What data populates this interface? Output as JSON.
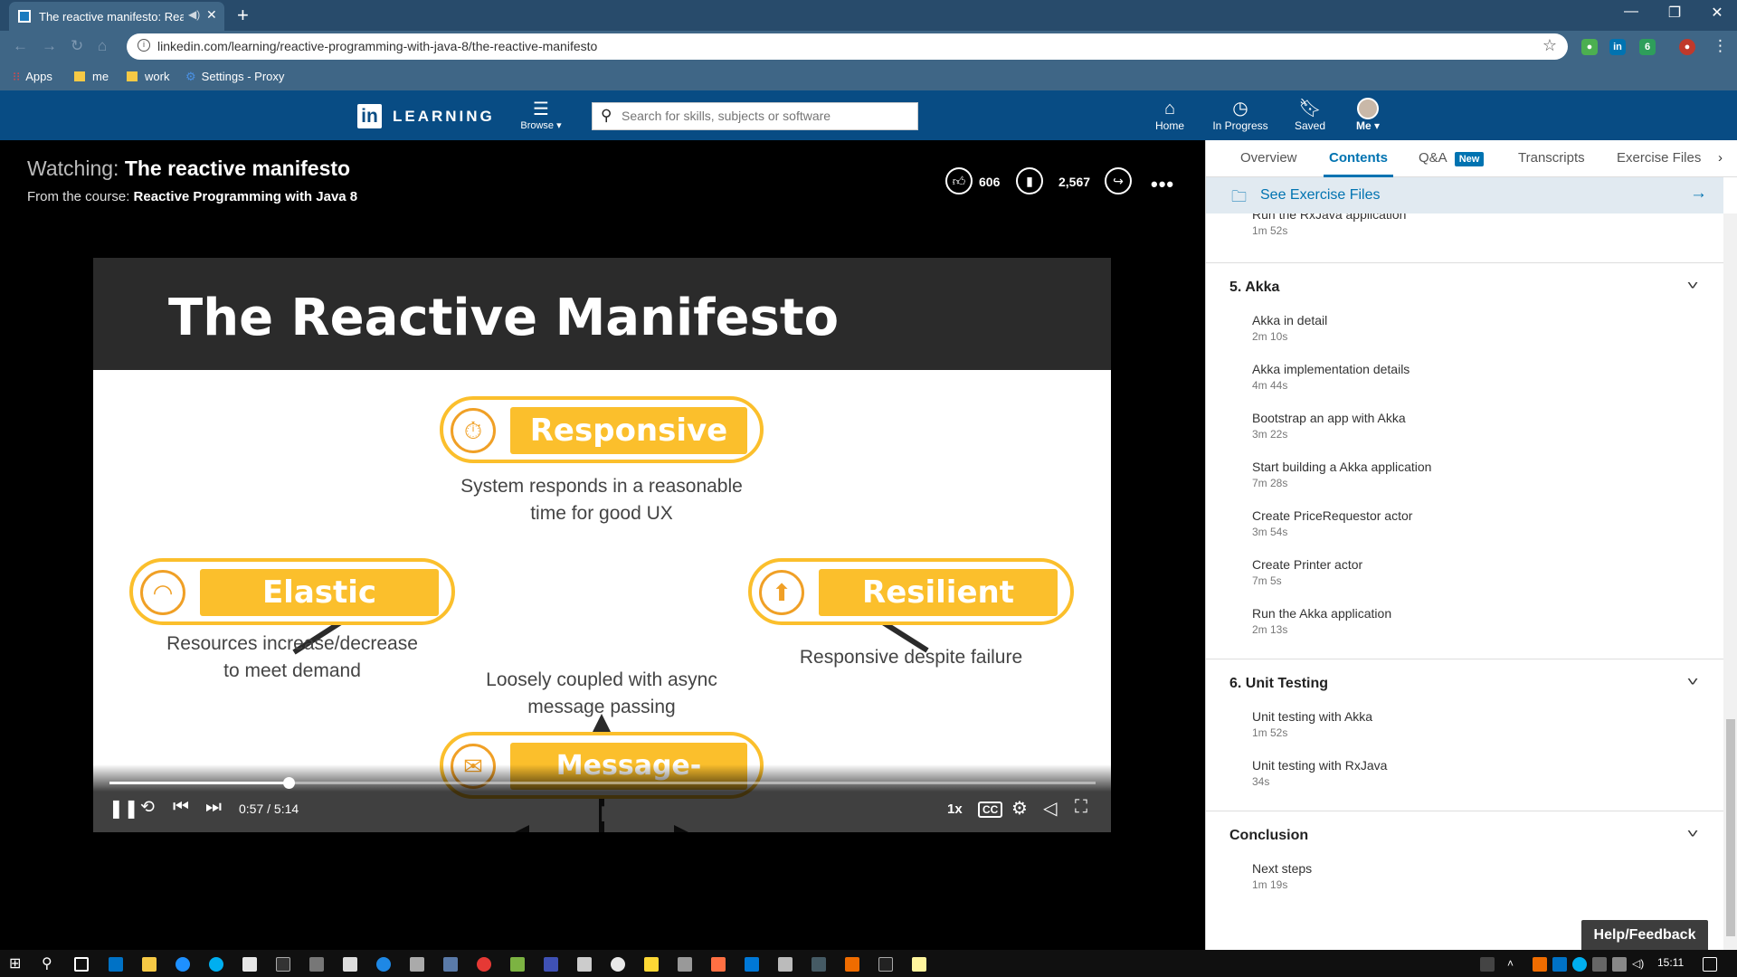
{
  "browser": {
    "tab_title": "The reactive manifesto: React",
    "url": "linkedin.com/learning/reactive-programming-with-java-8/the-reactive-manifesto",
    "bookmarks": [
      "Apps",
      "me",
      "work",
      "Settings - Proxy"
    ],
    "extension_badge": "6"
  },
  "header": {
    "logo": "in",
    "brand": "LEARNING",
    "browse": "Browse ▾",
    "search_placeholder": "Search for skills, subjects or software",
    "nav": [
      {
        "label": "Home",
        "icon": "home-icon"
      },
      {
        "label": "In Progress",
        "icon": "clock-icon"
      },
      {
        "label": "Saved",
        "icon": "bookmark-icon"
      },
      {
        "label": "Me ▾",
        "icon": "avatar"
      }
    ]
  },
  "video_info": {
    "watching_prefix": "Watching:",
    "title": "The reactive manifesto",
    "course_prefix": "From the course:",
    "course": "Reactive Programming with Java 8",
    "likes": "606",
    "saves": "2,567"
  },
  "slide": {
    "title": "The Reactive Manifesto",
    "responsive": {
      "label": "Responsive",
      "desc_1": "System responds in a reasonable",
      "desc_2": "time for good UX"
    },
    "elastic": {
      "label": "Elastic",
      "desc_1": "Resources increase/decrease",
      "desc_2": "to meet demand"
    },
    "resilient": {
      "label": "Resilient",
      "desc_1": "Responsive despite failure"
    },
    "message_driven": {
      "label": "Message-driven",
      "desc_1": "Loosely coupled with async",
      "desc_2": "message passing"
    },
    "accent_color": "#fbbf2c"
  },
  "player": {
    "time": "0:57 / 5:14",
    "progress_fraction": 0.182,
    "speed": "1x",
    "cc": "CC"
  },
  "panel": {
    "tabs": [
      "Overview",
      "Contents",
      "Q&A",
      "Transcripts",
      "Exercise Files"
    ],
    "new_badge": "New",
    "active_tab": "Contents",
    "exercise_files": "See Exercise Files",
    "prev_item": {
      "title": "Run the RxJava application",
      "duration": "1m 52s"
    },
    "chapters": [
      {
        "title": "5. Akka",
        "items": [
          {
            "title": "Akka in detail",
            "duration": "2m 10s"
          },
          {
            "title": "Akka implementation details",
            "duration": "4m 44s"
          },
          {
            "title": "Bootstrap an app with Akka",
            "duration": "3m 22s"
          },
          {
            "title": "Start building a Akka application",
            "duration": "7m 28s"
          },
          {
            "title": "Create PriceRequestor actor",
            "duration": "3m 54s"
          },
          {
            "title": "Create Printer actor",
            "duration": "7m 5s"
          },
          {
            "title": "Run the Akka application",
            "duration": "2m 13s"
          }
        ]
      },
      {
        "title": "6. Unit Testing",
        "items": [
          {
            "title": "Unit testing with Akka",
            "duration": "1m 52s"
          },
          {
            "title": "Unit testing with RxJava",
            "duration": "34s"
          }
        ]
      },
      {
        "title": "Conclusion",
        "items": [
          {
            "title": "Next steps",
            "duration": "1m 19s"
          }
        ]
      }
    ],
    "help": "Help/Feedback"
  },
  "taskbar": {
    "clock": "15:11"
  }
}
